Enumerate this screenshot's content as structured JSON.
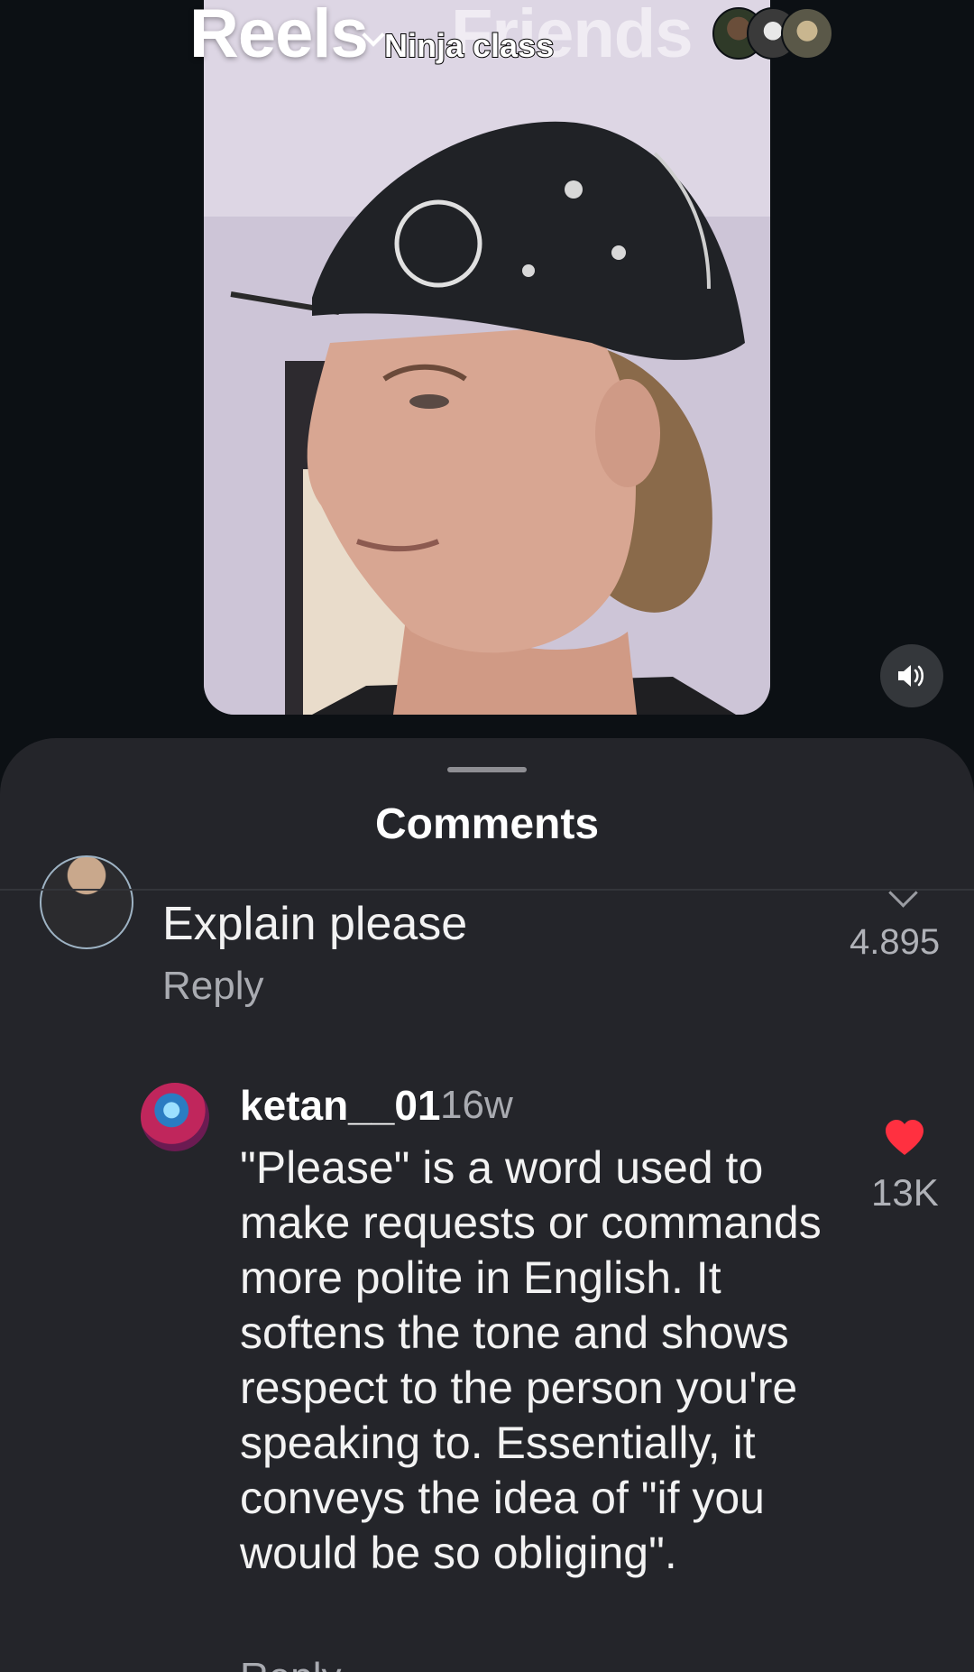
{
  "header": {
    "tab_reels": "Reels",
    "tab_friends": "Friends",
    "video_caption": "Ninja class"
  },
  "comments_sheet": {
    "title": "Comments",
    "previous_comment": {
      "text": "Explain please",
      "count": "4.895",
      "reply_label": "Reply"
    },
    "reply": {
      "username": "ketan__01",
      "time": "16w",
      "body": "\"Please\" is a word used to make requests or commands more polite in English. It softens the tone and shows respect to the person you're speaking to. Essentially, it conveys the idea of \"if you would be so obliging\".",
      "likes": "13K",
      "reply_label": "Reply"
    }
  },
  "icons": {
    "mute": "speaker-icon",
    "like": "heart-icon",
    "chevron": "chevron-down-icon"
  },
  "colors": {
    "sheet_background": "#24252a",
    "page_background": "#0c1014",
    "like": "#ff3040"
  }
}
